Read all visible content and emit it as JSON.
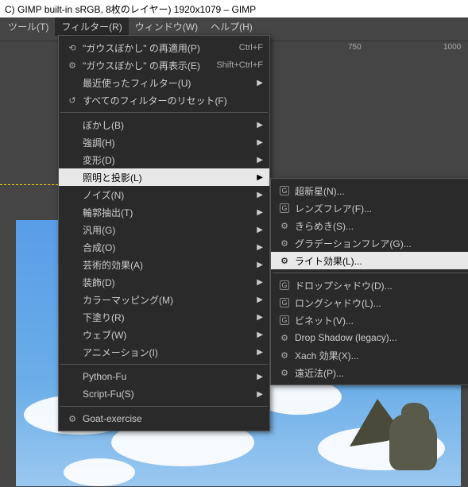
{
  "titlebar": "C) GIMP built-in sRGB, 8枚のレイヤー) 1920x1079 – GIMP",
  "menubar": {
    "items": [
      {
        "label": "ツール(T)"
      },
      {
        "label": "フィルター(R)"
      },
      {
        "label": "ウィンドウ(W)"
      },
      {
        "label": "ヘルプ(H)"
      }
    ]
  },
  "ruler_ticks": [
    "750",
    "1000"
  ],
  "filters_menu": {
    "top": [
      {
        "icon": "⟲",
        "label": "\"ガウスぼかし\" の再適用(P)",
        "shortcut": "Ctrl+F"
      },
      {
        "icon": "⚙",
        "label": "\"ガウスぼかし\" の再表示(E)",
        "shortcut": "Shift+Ctrl+F"
      },
      {
        "icon": "",
        "label": "最近使ったフィルター(U)",
        "submenu": true
      },
      {
        "icon": "↺",
        "label": "すべてのフィルターのリセット(F)"
      }
    ],
    "groups": [
      {
        "label": "ぼかし(B)",
        "submenu": true
      },
      {
        "label": "強調(H)",
        "submenu": true
      },
      {
        "label": "変形(D)",
        "submenu": true
      },
      {
        "label": "照明と投影(L)",
        "submenu": true,
        "highlighted": true
      },
      {
        "label": "ノイズ(N)",
        "submenu": true
      },
      {
        "label": "輪郭抽出(T)",
        "submenu": true
      },
      {
        "label": "汎用(G)",
        "submenu": true
      },
      {
        "label": "合成(O)",
        "submenu": true
      },
      {
        "label": "芸術的効果(A)",
        "submenu": true
      },
      {
        "label": "装飾(D)",
        "submenu": true
      },
      {
        "label": "カラーマッピング(M)",
        "submenu": true
      },
      {
        "label": "下塗り(R)",
        "submenu": true
      },
      {
        "label": "ウェブ(W)",
        "submenu": true
      },
      {
        "label": "アニメーション(I)",
        "submenu": true
      }
    ],
    "scripts": [
      {
        "label": "Python-Fu",
        "submenu": true
      },
      {
        "label": "Script-Fu(S)",
        "submenu": true
      }
    ],
    "extra": [
      {
        "icon": "⚙",
        "label": "Goat-exercise"
      }
    ]
  },
  "light_menu": {
    "group1": [
      {
        "gicon": "G",
        "label": "超新星(N)..."
      },
      {
        "gicon": "G",
        "label": "レンズフレア(F)..."
      },
      {
        "icon": "⚙",
        "label": "きらめき(S)..."
      },
      {
        "icon": "⚙",
        "label": "グラデーションフレア(G)..."
      },
      {
        "icon": "⚙",
        "label": "ライト効果(L)...",
        "highlighted": true
      }
    ],
    "group2": [
      {
        "gicon": "G",
        "label": "ドロップシャドウ(D)..."
      },
      {
        "gicon": "G",
        "label": "ロングシャドウ(L)..."
      },
      {
        "gicon": "G",
        "label": "ビネット(V)..."
      },
      {
        "icon": "⚙",
        "label": "Drop Shadow (legacy)..."
      },
      {
        "icon": "⚙",
        "label": "Xach 効果(X)..."
      },
      {
        "icon": "⚙",
        "label": "遠近法(P)..."
      }
    ]
  }
}
